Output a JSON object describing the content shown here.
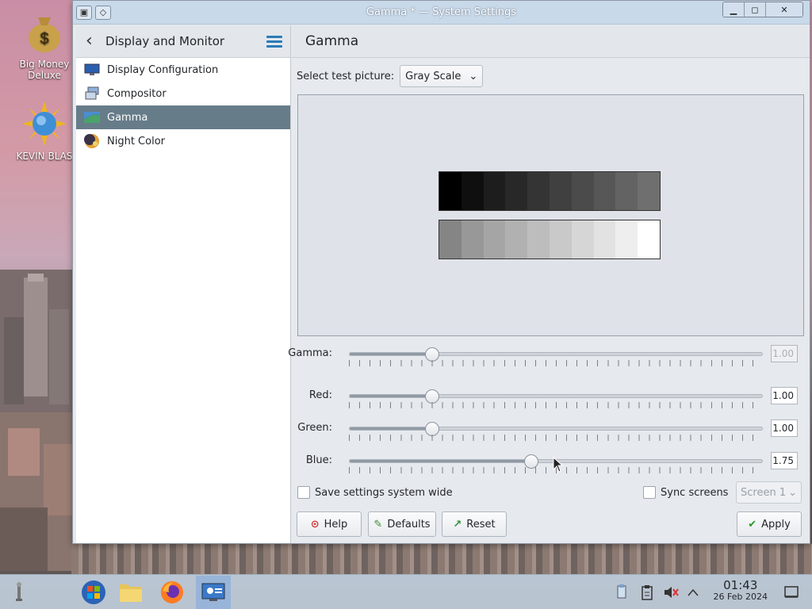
{
  "desktop": {
    "icons": [
      {
        "label": "Big Money Deluxe",
        "icon": "money-bag-icon"
      },
      {
        "label": "KEVIN BLAS",
        "icon": "sun-globe-icon"
      }
    ]
  },
  "window": {
    "title": "Gamma * — System Settings",
    "controls": {
      "minimize": "▁",
      "maximize": "◻",
      "close": "✕"
    }
  },
  "sidebar": {
    "back_label": "‹",
    "title": "Display and Monitor",
    "items": [
      {
        "label": "Display Configuration",
        "icon": "display-icon",
        "selected": false
      },
      {
        "label": "Compositor",
        "icon": "compositor-icon",
        "selected": false
      },
      {
        "label": "Gamma",
        "icon": "gamma-icon",
        "selected": true
      },
      {
        "label": "Night Color",
        "icon": "night-color-icon",
        "selected": false
      }
    ]
  },
  "content": {
    "title": "Gamma",
    "test_picture_label": "Select test picture:",
    "test_picture_value": "Gray Scale",
    "gray_ramp_top": [
      "#000000",
      "#0f0f0f",
      "#1d1d1d",
      "#282828",
      "#343434",
      "#404040",
      "#4b4b4b",
      "#575757",
      "#636363",
      "#6f6f6f"
    ],
    "gray_ramp_bottom": [
      "#858585",
      "#989898",
      "#a5a5a5",
      "#b1b1b1",
      "#bdbdbd",
      "#c9c9c9",
      "#d6d6d6",
      "#e2e2e2",
      "#eeeeee",
      "#ffffff"
    ],
    "sliders": [
      {
        "label": "Gamma:",
        "value": "1.00",
        "level": 0.2,
        "disabled": true
      },
      {
        "label": "Red:",
        "value": "1.00",
        "level": 0.2,
        "disabled": false
      },
      {
        "label": "Green:",
        "value": "1.00",
        "level": 0.2,
        "disabled": false
      },
      {
        "label": "Blue:",
        "value": "1.75",
        "level": 0.44,
        "disabled": false
      }
    ],
    "save_system_wide": "Save settings system wide",
    "sync_screens": "Sync screens",
    "screen_select": "Screen 1",
    "buttons": {
      "help": "Help",
      "defaults": "Defaults",
      "reset": "Reset",
      "apply": "Apply"
    }
  },
  "taskbar": {
    "time": "01:43",
    "date": "26 Feb 2024"
  }
}
